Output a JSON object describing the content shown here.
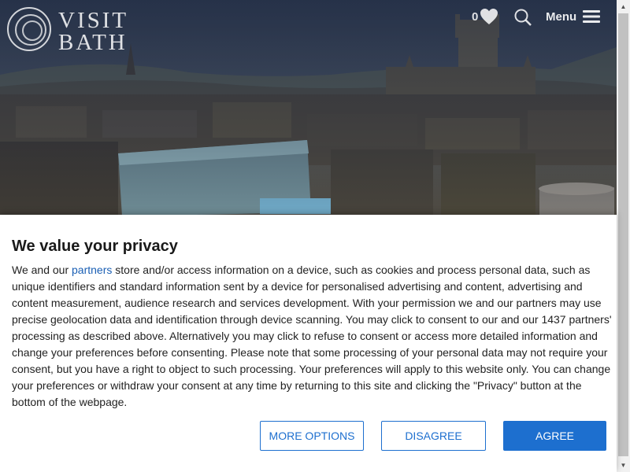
{
  "header": {
    "logo_line1": "VISIT",
    "logo_line2": "BATH",
    "favourites_count": "0",
    "menu_label": "Menu"
  },
  "consent": {
    "title": "We value your privacy",
    "body_pre": "We and our ",
    "partners_link": "partners",
    "body_post": " store and/or access information on a device, such as cookies and process personal data, such as unique identifiers and standard information sent by a device for personalised advertising and content, advertising and content measurement, audience research and services development. With your permission we and our partners may use precise geolocation data and identification through device scanning. You may click to consent to our and our 1437 partners' processing as described above. Alternatively you may click to refuse to consent or access more detailed information and change your preferences before consenting. Please note that some processing of your personal data may not require your consent, but you have a right to object to such processing. Your preferences will apply to this website only. You can change your preferences or withdraw your consent at any time by returning to this site and clicking the \"Privacy\" button at the bottom of the webpage.",
    "more_options_label": "MORE OPTIONS",
    "disagree_label": "DISAGREE",
    "agree_label": "AGREE"
  },
  "colors": {
    "accent": "#1d6fcf",
    "link": "#1a5fb4"
  },
  "icons": {
    "logo": "logo-ring-icon",
    "favourites": "heart-icon",
    "search": "search-icon",
    "menu": "hamburger-icon"
  }
}
